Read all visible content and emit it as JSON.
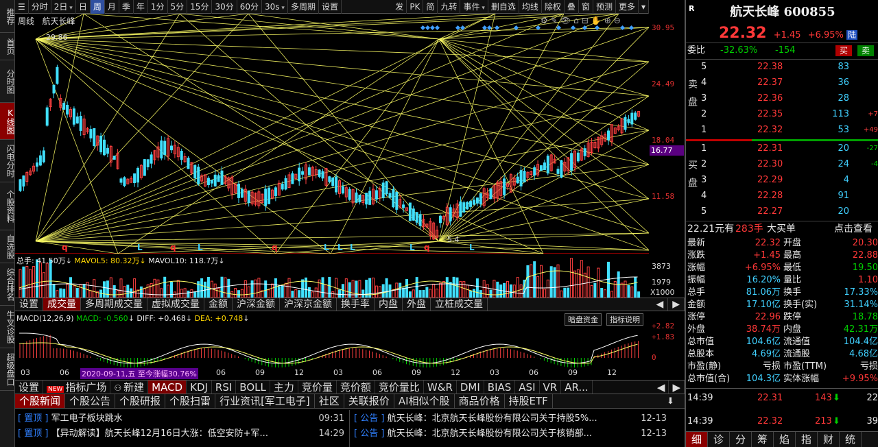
{
  "leftnav": [
    "推荐",
    "首页",
    "分时图",
    "K线图",
    "闪电分时",
    "个股资料",
    "自选股",
    "综合排名",
    "牛叉诊股",
    "超级盘口"
  ],
  "toolbar": {
    "items": [
      "分时",
      "2日",
      "日",
      "周",
      "月",
      "季",
      "年",
      "1分",
      "5分",
      "15分",
      "30分",
      "60分",
      "30s",
      "多周期",
      "设置"
    ],
    "right_items": [
      "发",
      "PK",
      "简",
      "九转",
      "事件",
      "删自选",
      "均线",
      "除权",
      "叠",
      "窗",
      "预测",
      "更多"
    ]
  },
  "chart": {
    "title_period": "周线",
    "title_name": "航天长峰",
    "price_high_label": "29.86",
    "price_low_label": "5.4",
    "y_ticks": [
      "30.95",
      "24.49",
      "18.04",
      "11.58"
    ],
    "current_price_marker": "16.77",
    "markers_q": [
      "q",
      "q",
      "q",
      "q"
    ],
    "markers_l": [
      "L",
      "L",
      "L",
      "L",
      "L",
      "L",
      "L"
    ],
    "tools": [
      "⚙",
      "✎",
      "👁",
      "⌂",
      "⊟",
      "✋",
      "⊕",
      "⊖"
    ]
  },
  "volume": {
    "legend_total": "总手: 41.50万",
    "legend_ma5": "MAVOL5: 80.32万",
    "legend_ma10": "MAVOL10: 118.7万",
    "y_ticks": [
      "3873",
      "1979",
      "X1000"
    ]
  },
  "ind_tabs": [
    "设置",
    "成交量",
    "多周期成交量",
    "虚拟成交量",
    "金额",
    "沪深金额",
    "沪深京金额",
    "换手率",
    "内盘",
    "外盘",
    "立桩成交量"
  ],
  "macd": {
    "legend_name": "MACD(12,26,9)",
    "legend_macd": "MACD: -0.560",
    "legend_diff": "DIFF: +0.468",
    "legend_dea": "DEA: +0.748",
    "btn1": "暗盘资金",
    "btn2": "指标说明",
    "y_ticks": [
      "+2.82",
      "+1.83",
      "0"
    ],
    "x_ticks": [
      "03",
      "06",
      "09",
      "12",
      "03",
      "06",
      "09",
      "12",
      "03",
      "06",
      "09",
      "12",
      "03",
      "06",
      "09",
      "12"
    ],
    "date_tip": "2020-09-11,五 至今涨幅30.76%"
  },
  "indicator_bar": [
    "设置",
    "指标广场",
    "新建",
    "MACD",
    "KDJ",
    "RSI",
    "BOLL",
    "主力",
    "竞价量",
    "竞价额",
    "竞价量比",
    "W&R",
    "DMI",
    "BIAS",
    "ASI",
    "VR",
    "AR..."
  ],
  "indicator_bar_badge": "NEW",
  "news_tabs": [
    "个股新闻",
    "个股公告",
    "个股研报",
    "个股扫雷",
    "行业资讯[军工电子]",
    "社区",
    "关联报价",
    "AI相似个股",
    "商品价格",
    "持股ETF"
  ],
  "news_left": [
    {
      "tag": "置顶",
      "title": "军工电子板块跳水",
      "time": "09:31"
    },
    {
      "tag": "置顶",
      "title": "【异动解读】航天长峰12月16日大涨：低空安防+军...",
      "time": "14:29"
    }
  ],
  "news_right": [
    {
      "tag": "公告",
      "title": "航天长峰：北京航天长峰股份有限公司关于持股5%...",
      "time": "12-13"
    },
    {
      "tag": "公告",
      "title": "航天长峰：北京航天长峰股份有限公司关于核销部...",
      "time": "12-13"
    }
  ],
  "quote": {
    "corner": "R",
    "name_code": "航天长峰 600855",
    "price": "22.32",
    "change": "+1.45",
    "pct": "+6.95%",
    "tag": "陆",
    "weibi_label": "委比",
    "weibi": "-32.63%",
    "weicha": "-154",
    "buy_btn": "买",
    "sell_btn": "卖",
    "sell_label": "卖盘",
    "buy_label": "买盘",
    "asks": [
      {
        "lvl": "5",
        "price": "22.38",
        "vol": "83",
        "chg": ""
      },
      {
        "lvl": "4",
        "price": "22.37",
        "vol": "36",
        "chg": ""
      },
      {
        "lvl": "3",
        "price": "22.36",
        "vol": "28",
        "chg": ""
      },
      {
        "lvl": "2",
        "price": "22.35",
        "vol": "113",
        "chg": "+7"
      },
      {
        "lvl": "1",
        "price": "22.32",
        "vol": "53",
        "chg": "+49"
      }
    ],
    "bids": [
      {
        "lvl": "1",
        "price": "22.31",
        "vol": "20",
        "chg": "-27"
      },
      {
        "lvl": "2",
        "price": "22.30",
        "vol": "24",
        "chg": "-4"
      },
      {
        "lvl": "3",
        "price": "22.29",
        "vol": "4",
        "chg": ""
      },
      {
        "lvl": "4",
        "price": "22.28",
        "vol": "91",
        "chg": ""
      },
      {
        "lvl": "5",
        "price": "22.27",
        "vol": "20",
        "chg": ""
      }
    ],
    "bigorder_price": "22.21元有",
    "bigorder_vol": "283手",
    "bigorder_label": "大买单",
    "bigorder_link": "点击查看",
    "stats": [
      {
        "l1": "最新",
        "v1": "22.32",
        "c1": "red",
        "l2": "开盘",
        "v2": "20.30",
        "c2": "red"
      },
      {
        "l1": "涨跌",
        "v1": "+1.45",
        "c1": "red",
        "l2": "最高",
        "v2": "22.88",
        "c2": "red"
      },
      {
        "l1": "涨幅",
        "v1": "+6.95%",
        "c1": "red",
        "l2": "最低",
        "v2": "19.50",
        "c2": "green"
      },
      {
        "l1": "振幅",
        "v1": "16.20%",
        "c1": "cyan",
        "l2": "量比",
        "v2": "1.10",
        "c2": "red"
      },
      {
        "l1": "总手",
        "v1": "81.06万",
        "c1": "cyan",
        "l2": "换手",
        "v2": "17.33%",
        "c2": "cyan"
      },
      {
        "l1": "金额",
        "v1": "17.10亿",
        "c1": "cyan",
        "l2": "换手(实)",
        "v2": "31.14%",
        "c2": "cyan"
      },
      {
        "l1": "涨停",
        "v1": "22.96",
        "c1": "red",
        "l2": "跌停",
        "v2": "18.78",
        "c2": "green"
      },
      {
        "l1": "外盘",
        "v1": "38.74万",
        "c1": "red",
        "l2": "内盘",
        "v2": "42.31万",
        "c2": "green"
      },
      {
        "l1": "总市值",
        "v1": "104.6亿",
        "c1": "cyan",
        "l2": "流通值",
        "v2": "104.4亿",
        "c2": "cyan"
      },
      {
        "l1": "总股本",
        "v1": "4.69亿",
        "c1": "cyan",
        "l2": "流通股",
        "v2": "4.68亿",
        "c2": "cyan"
      },
      {
        "l1": "市盈(静)",
        "v1": "亏损",
        "c1": "white",
        "l2": "市盈(TTM)",
        "v2": "亏损",
        "c2": "white"
      },
      {
        "l1": "总市值(合)",
        "v1": "104.3亿",
        "c1": "cyan",
        "l2": "实体涨幅",
        "v2": "+9.95%",
        "c2": "red"
      }
    ],
    "ticks": [
      {
        "time": "14:39",
        "price": "22.31",
        "vol": "143",
        "arrow": "down",
        "n": "22"
      },
      {
        "time": "14:39",
        "price": "22.32",
        "vol": "213",
        "arrow": "down",
        "n": "39"
      }
    ],
    "bottom_tabs": [
      "细",
      "诊",
      "分",
      "筹",
      "焰",
      "指",
      "财",
      "统"
    ]
  }
}
